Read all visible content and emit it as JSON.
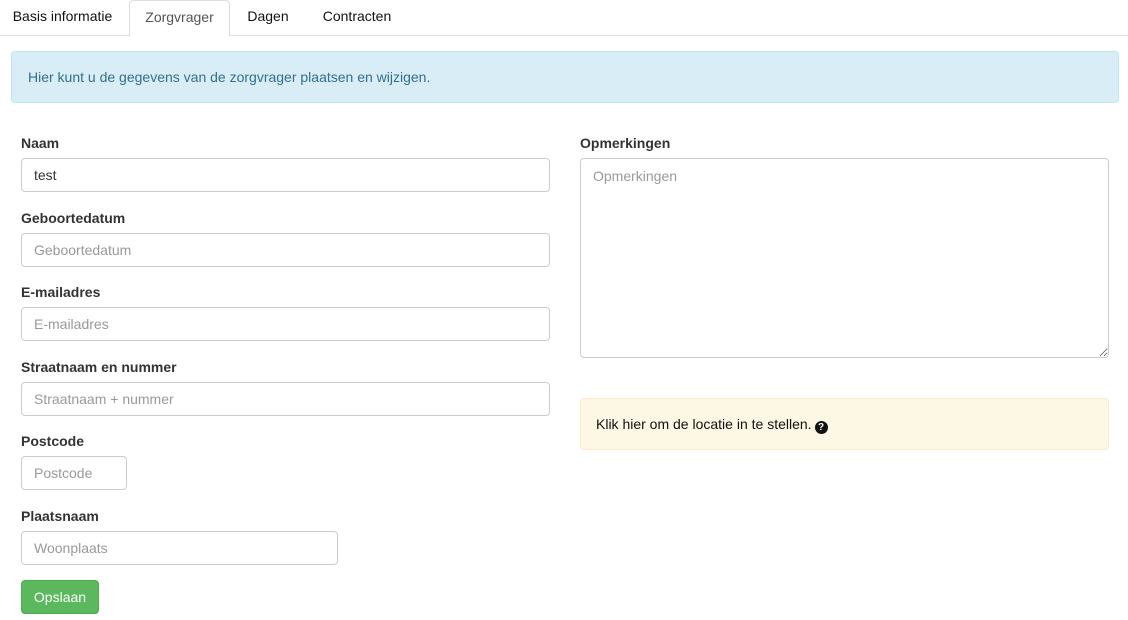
{
  "tabs": [
    {
      "label": "Basis informatie"
    },
    {
      "label": "Zorgvrager"
    },
    {
      "label": "Dagen"
    },
    {
      "label": "Contracten"
    }
  ],
  "info_message": "Hier kunt u de gegevens van de zorgvrager plaatsen en wijzigen.",
  "form": {
    "naam": {
      "label": "Naam",
      "value": "test"
    },
    "geboortedatum": {
      "label": "Geboortedatum",
      "placeholder": "Geboortedatum"
    },
    "email": {
      "label": "E-mailadres",
      "placeholder": "E-mailadres"
    },
    "straat": {
      "label": "Straatnaam en nummer",
      "placeholder": "Straatnaam + nummer"
    },
    "postcode": {
      "label": "Postcode",
      "placeholder": "Postcode"
    },
    "plaats": {
      "label": "Plaatsnaam",
      "placeholder": "Woonplaats"
    },
    "opmerkingen": {
      "label": "Opmerkingen",
      "placeholder": "Opmerkingen"
    },
    "save_label": "Opslaan"
  },
  "location_notice": "Klik hier om de locatie in te stellen.",
  "help_icon": {
    "name": "question-circle-icon",
    "glyph": "?"
  },
  "colors": {
    "info_bg": "#d9edf7",
    "info_text": "#31708f",
    "warning_bg": "#fcf8e3",
    "save_button": "#5cb85c"
  }
}
